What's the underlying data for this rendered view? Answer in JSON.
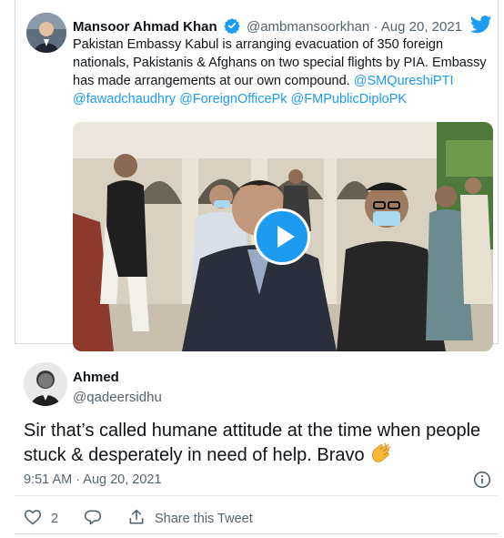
{
  "parent_tweet": {
    "author_name": "Mansoor Ahmad Khan",
    "handle": "@ambmansoorkhan",
    "separator": "·",
    "date": "Aug 20, 2021",
    "text_intro": "Pakistan Embassy Kabul is arranging evacuation of 350 foreign nationals, Pakistanis & Afghans on two special flights by PIA. Embassy has made arrangements  at our own compound. ",
    "mentions": [
      "@SMQureshiPTI",
      "@fawadchaudhry",
      "@ForeignOfficePk",
      "@FMPublicDiploPK"
    ]
  },
  "reply_tweet": {
    "author_name": "Ahmed",
    "handle": "@qadeersidhu",
    "text": "Sir that’s called humane attitude at the time when people stuck & desperately in need of help. Bravo ",
    "emoji": "👏",
    "timestamp": "9:51 AM · Aug 20, 2021",
    "like_count": "2",
    "share_label": "Share this Tweet"
  },
  "icons": {
    "verified": "verified-badge-icon",
    "brand": "twitter-bird-icon",
    "play": "play-icon",
    "info": "info-icon",
    "like": "heart-icon",
    "reply": "reply-icon",
    "share": "share-icon"
  },
  "colors": {
    "accent": "#1d9bf0",
    "secondary_text": "#536471",
    "primary_text": "#0f1419",
    "border": "#cfd9de"
  }
}
